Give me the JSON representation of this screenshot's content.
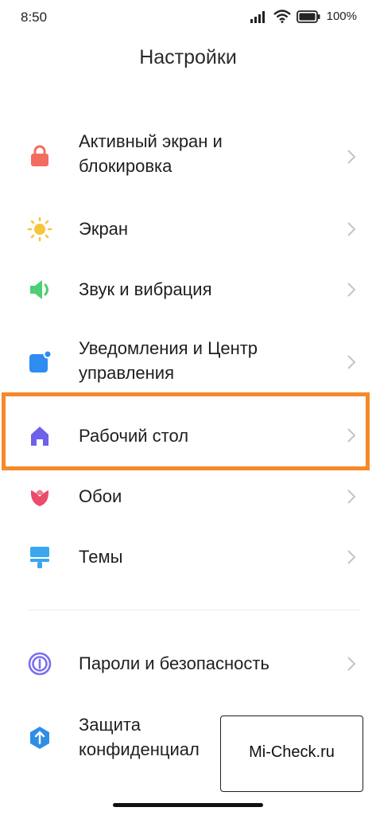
{
  "status_bar": {
    "time": "8:50",
    "battery_percent": "100%",
    "icons": [
      "signal-icon",
      "wifi-icon",
      "battery-icon"
    ]
  },
  "page": {
    "title": "Настройки"
  },
  "settings": [
    {
      "label_line1": "Активный экран и",
      "label_line2": "блокировка",
      "icon": "lock-icon",
      "color": "#f26d5f"
    },
    {
      "label_line1": "Экран",
      "label_line2": "",
      "icon": "sun-icon",
      "color": "#f7c53a"
    },
    {
      "label_line1": "Звук и вибрация",
      "label_line2": "",
      "icon": "speaker-icon",
      "color": "#4ccf73"
    },
    {
      "label_line1": "Уведомления и Центр",
      "label_line2": "управления",
      "icon": "notification-icon",
      "color": "#2f8cf0"
    },
    {
      "label_line1": "Рабочий стол",
      "label_line2": "",
      "icon": "home-icon",
      "color": "#6e62e8",
      "highlighted": true
    },
    {
      "label_line1": "Обои",
      "label_line2": "",
      "icon": "flower-icon",
      "color": "#ea4c6c"
    },
    {
      "label_line1": "Темы",
      "label_line2": "",
      "icon": "brush-icon",
      "color": "#3aa6ef"
    },
    {
      "label_line1": "Пароли и безопасность",
      "label_line2": "",
      "icon": "fingerprint-icon",
      "color": "#7a6ff0"
    },
    {
      "label_line1": "Защита",
      "label_line2": "конфиденциал",
      "icon": "shield-icon",
      "color": "#2e8ee6"
    }
  ],
  "watermark": {
    "text": "Mi-Check.ru"
  },
  "colors": {
    "highlight": "#f5892a",
    "chevron": "#c4c4c4"
  }
}
